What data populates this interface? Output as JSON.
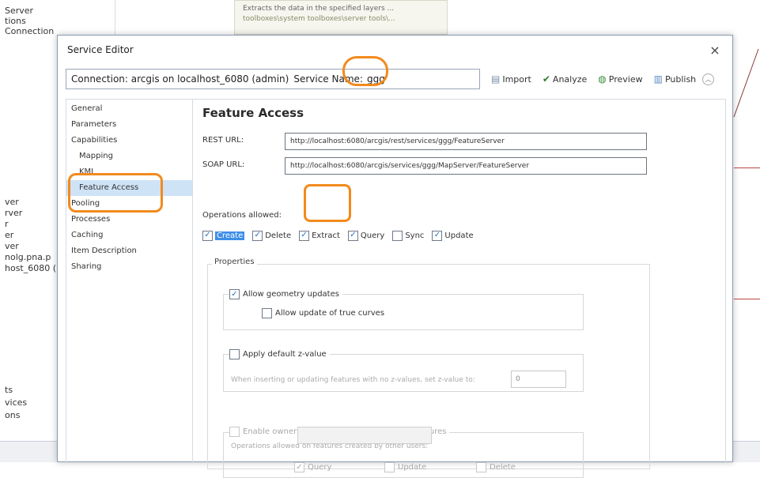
{
  "background": {
    "left_panel_items_top": [
      "Server",
      "tions",
      "Connection"
    ],
    "left_panel_items_mid": [
      "ver",
      "rver",
      "r",
      "er",
      "ver",
      "nolg.pna.p",
      "host_6080 ("
    ],
    "left_panel_items_bottom": [
      "ts",
      "vices",
      "ons"
    ],
    "tooltip_line1": "Extracts the data in the specified layers ...",
    "tooltip_line2": "toolboxes\\system toolboxes\\server tools\\..."
  },
  "dialog": {
    "title": "Service Editor",
    "close_glyph": "×"
  },
  "toolbar": {
    "connection_text": "Connection: arcgis on localhost_6080 (admin)",
    "service_name_label": "Service Name:",
    "service_name_value": "ggg",
    "import_label": "Import",
    "analyze_label": "Analyze",
    "preview_label": "Preview",
    "publish_label": "Publish"
  },
  "nav": {
    "general": "General",
    "parameters": "Parameters",
    "capabilities": "Capabilities",
    "mapping": "Mapping",
    "kml": "KML",
    "feature_access": "Feature Access",
    "pooling": "Pooling",
    "processes": "Processes",
    "caching": "Caching",
    "item_description": "Item Description",
    "sharing": "Sharing"
  },
  "content": {
    "title": "Feature Access",
    "rest_label": "REST URL:",
    "rest_url": "http://localhost:6080/arcgis/rest/services/ggg/FeatureServer",
    "soap_label": "SOAP URL:",
    "soap_url": "http://localhost:6080/arcgis/services/ggg/MapServer/FeatureServer",
    "operations_label": "Operations allowed:",
    "operations": {
      "create": "Create",
      "delete": "Delete",
      "extract": "Extract",
      "query": "Query",
      "sync": "Sync",
      "update": "Update"
    },
    "properties_label": "Properties",
    "allow_geometry_updates": "Allow geometry updates",
    "allow_update_true_curves": "Allow update of true curves",
    "apply_default_z": "Apply default z-value",
    "z_hint": "When inserting or updating features with no z-values, set z-value to:",
    "z_value": "0",
    "enable_ownership": "Enable ownership-based access control on features",
    "ops_on_others": "Operations allowed on features created by other users:",
    "owner_query": "Query",
    "owner_update": "Update",
    "owner_delete": "Delete"
  },
  "check_glyph": "✓",
  "colors": {
    "selection": "#cfe3f6",
    "highlight": "#3d8ee8",
    "annotation": "#f28a1c"
  }
}
